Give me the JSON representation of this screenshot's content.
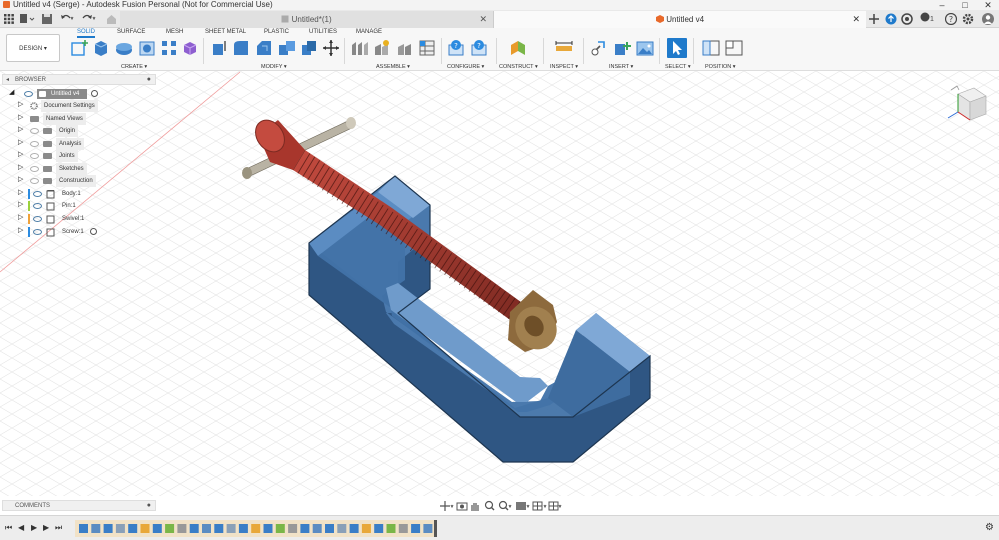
{
  "titlebar": {
    "title": "Untitled v4 (Serge) - Autodesk Fusion Personal (Not for Commercial Use)",
    "minimize": "–",
    "maximize": "□",
    "close": "✕"
  },
  "tabs": {
    "inactive": "Untitled*(1)",
    "active": "Untitled v4",
    "close": "✕",
    "notif_count": "1"
  },
  "ribbon": {
    "workspace": "DESIGN ▾",
    "tabs": [
      "SOLID",
      "SURFACE",
      "MESH",
      "SHEET METAL",
      "PLASTIC",
      "UTILITIES",
      "MANAGE"
    ],
    "groups": [
      "CREATE ▾",
      "MODIFY ▾",
      "ASSEMBLE ▾",
      "CONFIGURE ▾",
      "CONSTRUCT ▾",
      "INSPECT ▾",
      "INSERT ▾",
      "SELECT ▾",
      "POSITION ▾"
    ]
  },
  "browser": {
    "title": "BROWSER",
    "root": "Untitled v4",
    "items": [
      {
        "label": "Document Settings"
      },
      {
        "label": "Named Views"
      },
      {
        "label": "Origin"
      },
      {
        "label": "Analysis"
      },
      {
        "label": "Joints"
      },
      {
        "label": "Sketches"
      },
      {
        "label": "Construction"
      },
      {
        "label": "Body:1",
        "color": "#2b8be0"
      },
      {
        "label": "Pin:1",
        "color": "#9bd13c"
      },
      {
        "label": "Swivel:1",
        "color": "#f0a23a"
      },
      {
        "label": "Screw:1",
        "color": "#2b8be0"
      }
    ]
  },
  "comments": {
    "title": "COMMENTS"
  },
  "colors": {
    "accent": "#1f7acb",
    "body": "#3f6a97",
    "screw": "#a8362c",
    "swivel": "#8d6a3d",
    "pin": "#b9b3a4"
  }
}
